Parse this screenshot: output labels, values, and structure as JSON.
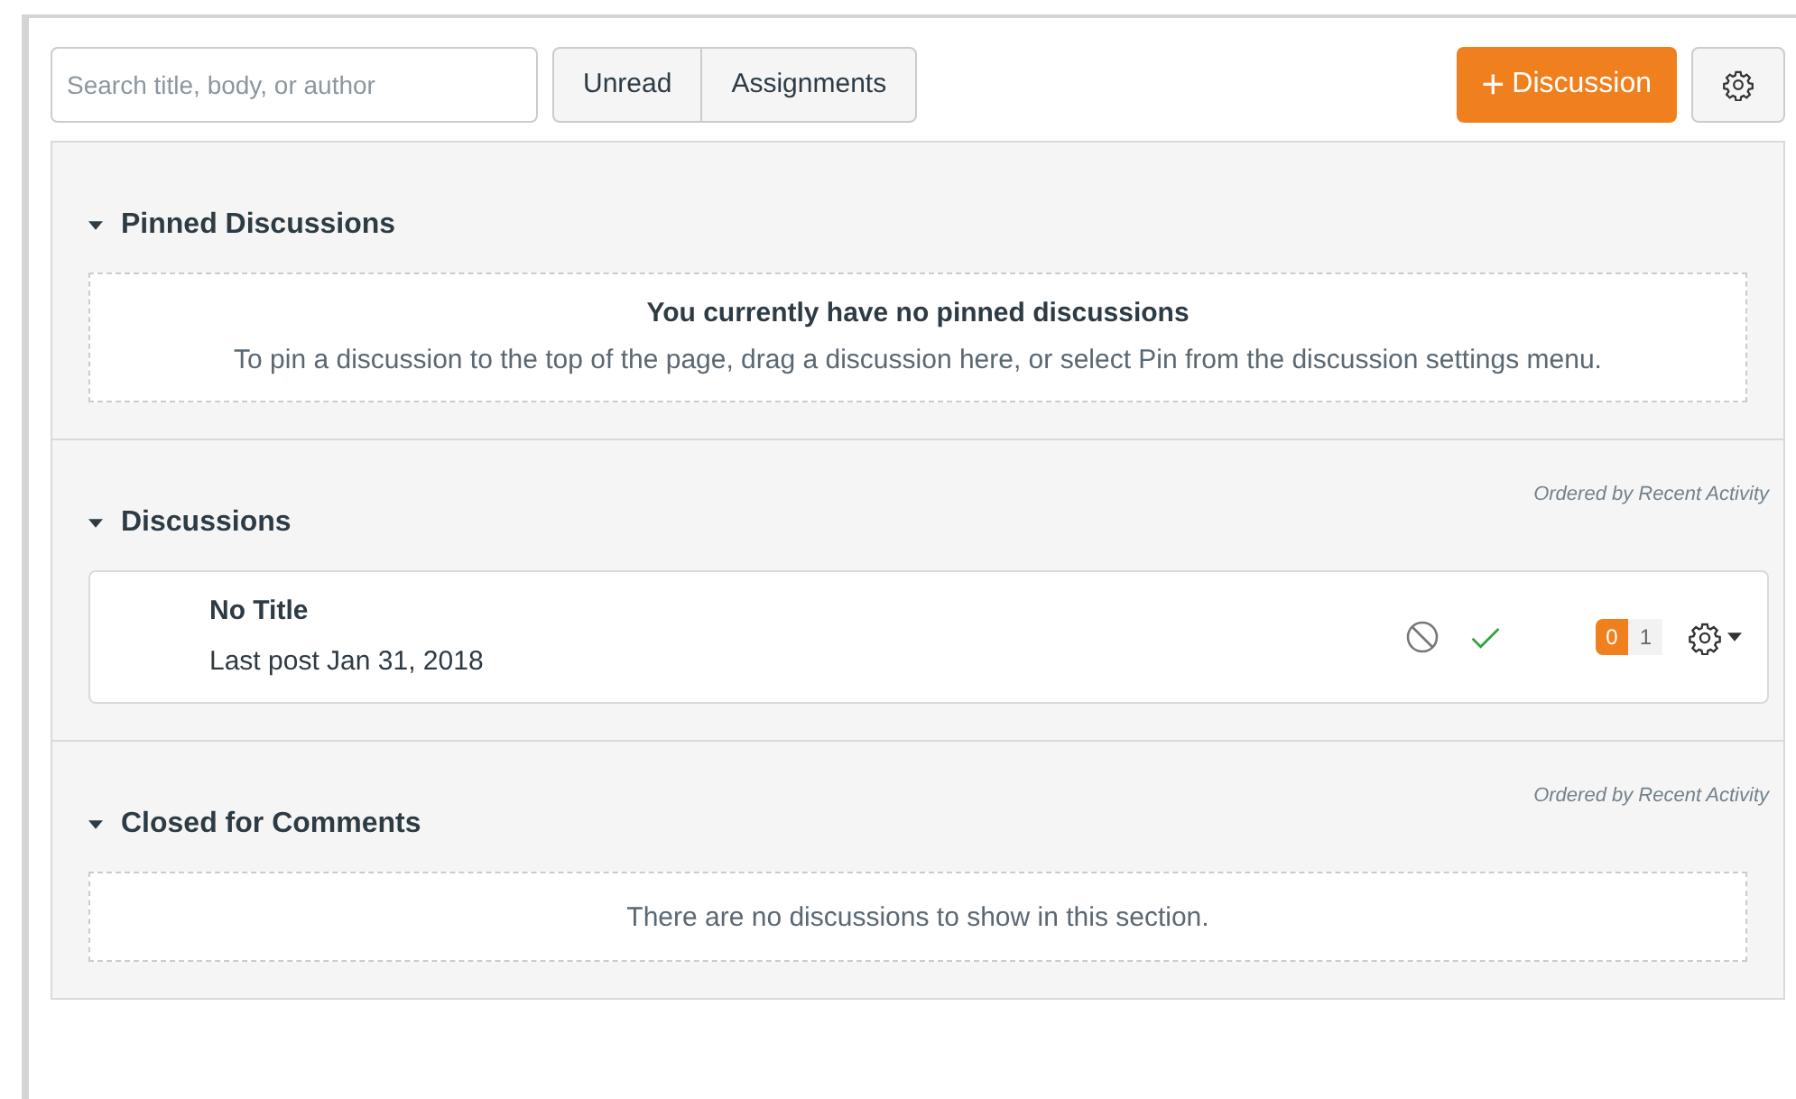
{
  "toolbar": {
    "search": {
      "placeholder": "Search title, body, or author"
    },
    "filters": [
      {
        "label": "Unread",
        "selected": false
      },
      {
        "label": "Assignments",
        "selected": false
      }
    ],
    "add_button": {
      "icon": "+",
      "label": "Discussion"
    }
  },
  "sections": [
    {
      "title": "Pinned Discussions",
      "expanded": true,
      "empty": {
        "title": "You currently have no pinned discussions",
        "text": "To pin a discussion to the top of the page, drag a discussion here, or select Pin from the discussion settings menu."
      }
    },
    {
      "title": "Discussions",
      "expanded": true,
      "order_note": "Ordered by Recent Activity",
      "items": [
        {
          "title": "No Title",
          "last_post": "Last post Jan 31, 2018",
          "unread": "0",
          "total": "1"
        }
      ]
    },
    {
      "title": "Closed for Comments",
      "expanded": true,
      "order_note": "Ordered by Recent Activity",
      "empty": {
        "text": "There are no discussions to show in this section."
      }
    }
  ]
}
